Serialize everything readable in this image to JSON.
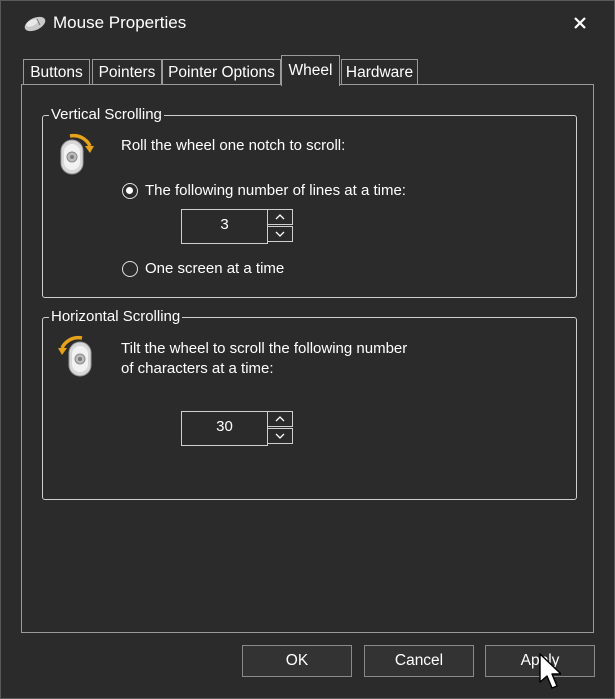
{
  "window": {
    "title": "Mouse Properties"
  },
  "tabs": [
    {
      "label": "Buttons"
    },
    {
      "label": "Pointers"
    },
    {
      "label": "Pointer Options"
    },
    {
      "label": "Wheel",
      "active": true
    },
    {
      "label": "Hardware"
    }
  ],
  "vertical": {
    "group_title": "Vertical Scrolling",
    "instruction": "Roll the wheel one notch to scroll:",
    "option_lines_label": "The following number of lines at a time:",
    "option_lines_checked": true,
    "lines_value": "3",
    "option_screen_label": "One screen at a time",
    "option_screen_checked": false
  },
  "horizontal": {
    "group_title": "Horizontal Scrolling",
    "instruction_line1": "Tilt the wheel to scroll the following number",
    "instruction_line2": "of characters at a time:",
    "chars_value": "30"
  },
  "footer": {
    "ok_label": "OK",
    "cancel_label": "Cancel",
    "apply_label": "Apply"
  },
  "colors": {
    "background": "#2b2b2b",
    "border": "#9a9a9a",
    "text": "#ffffff",
    "icon_accent": "#e6a21a"
  },
  "icons": {
    "title": "mouse-icon",
    "close": "close-icon",
    "vertical_group": "mouse-wheel-vertical-icon",
    "horizontal_group": "mouse-wheel-horizontal-icon"
  }
}
